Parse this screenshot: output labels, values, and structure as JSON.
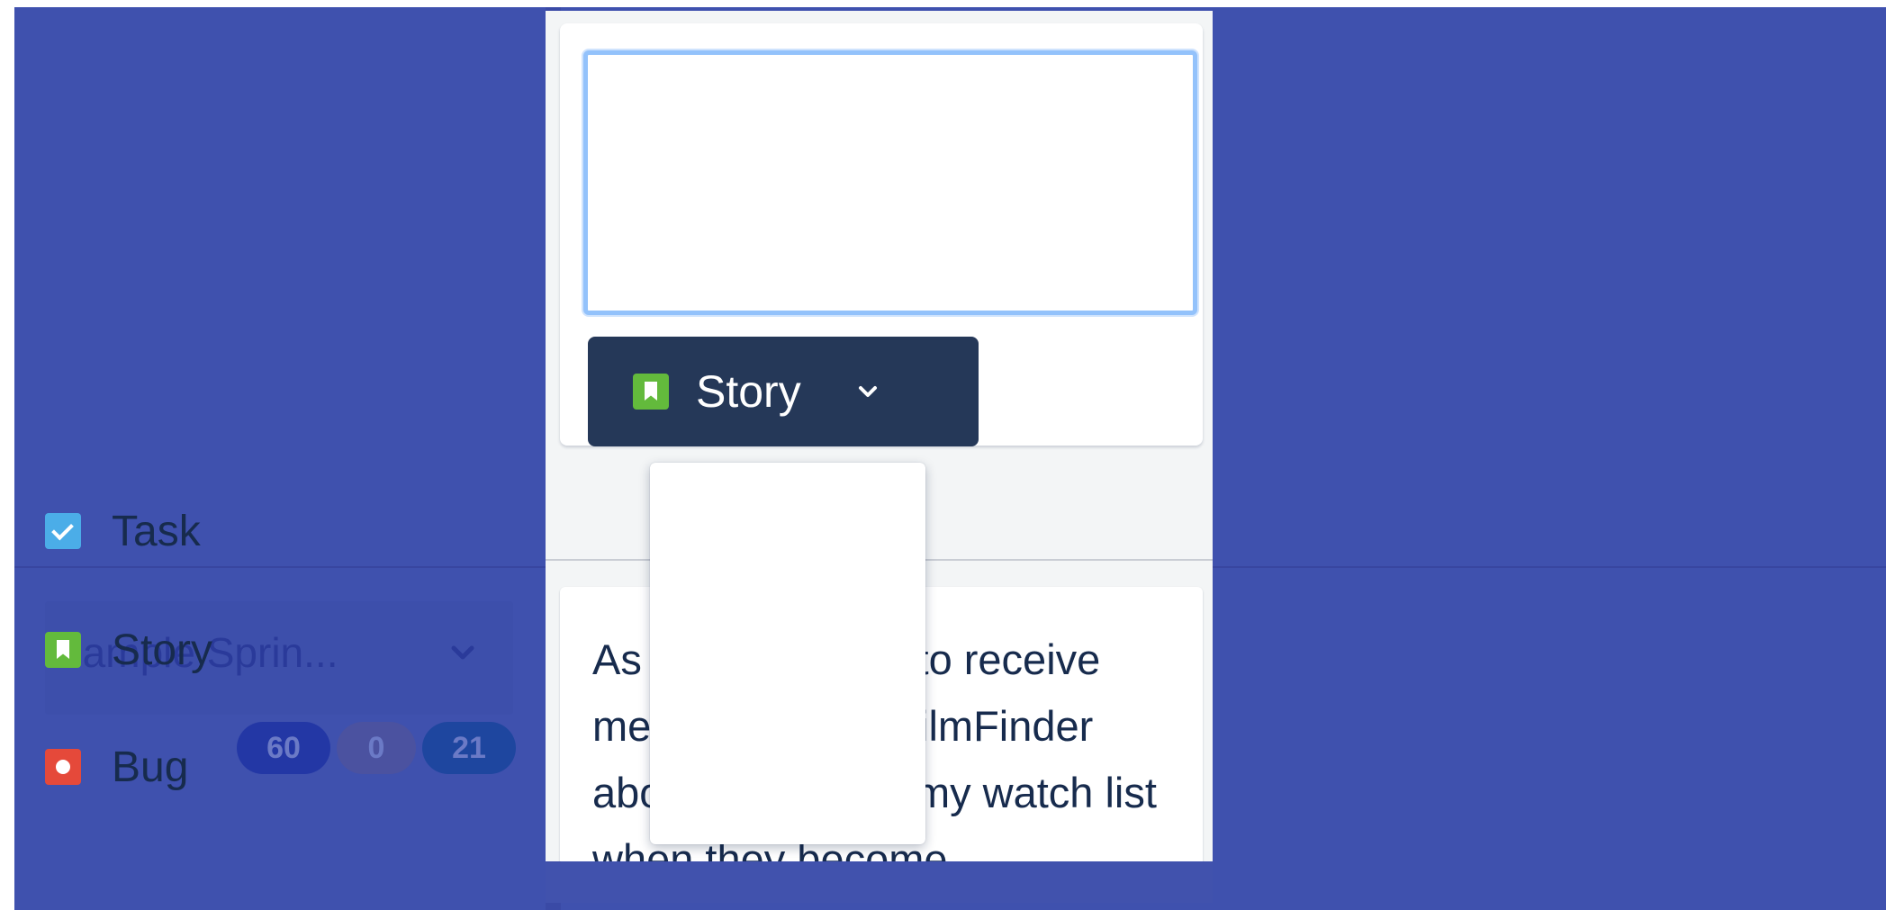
{
  "sprint": {
    "title": "Sample Sprin...",
    "badges": [
      "60",
      "0",
      "21"
    ]
  },
  "create": {
    "summary_value": "",
    "type_selected": "Story",
    "type_icon": "story-icon"
  },
  "menu": {
    "items": [
      {
        "label": "Task",
        "icon": "task-icon"
      },
      {
        "label": "Story",
        "icon": "story-icon"
      },
      {
        "label": "Bug",
        "icon": "bug-icon"
      }
    ]
  },
  "card": {
    "text": "As a user, I want to receive messages from FilmFinder about movies on my watch list when they become"
  },
  "colors": {
    "background": "#3f51ae",
    "select_bg": "#253858",
    "story": "#63ba3c",
    "task": "#4bade8",
    "bug": "#e5493a",
    "focus": "#93c2fb"
  }
}
